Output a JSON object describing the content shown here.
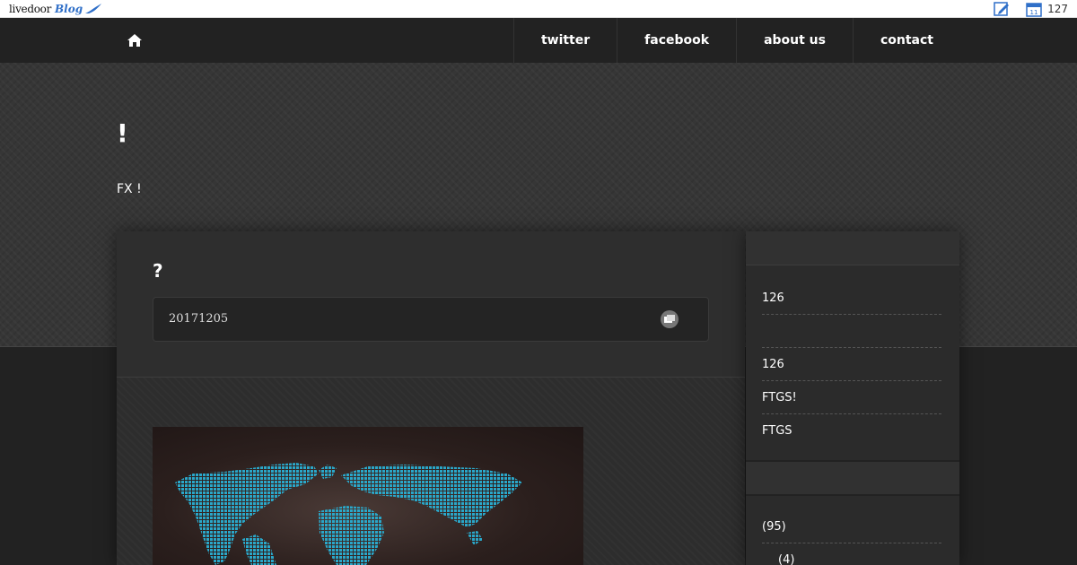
{
  "topbar": {
    "logo_text": "livedoor",
    "logo_blog": "Blog",
    "count": "127",
    "icons": [
      "edit-icon",
      "calendar-icon"
    ]
  },
  "nav": {
    "home_icon": "home-icon",
    "items": [
      {
        "label": "twitter"
      },
      {
        "label": "facebook"
      },
      {
        "label": "about us"
      },
      {
        "label": "contact"
      }
    ]
  },
  "header": {
    "title": "!",
    "description": "FX !"
  },
  "article": {
    "title": "?",
    "date": "20171205",
    "comment_icon": "comment-icon",
    "image": "world-map-image"
  },
  "sidebar": {
    "items1": [
      "126",
      "",
      "126",
      "FTGS!",
      "FTGS"
    ],
    "items2": [
      " (95)",
      "(4)"
    ]
  },
  "colors": {
    "nav_bg": "#222222",
    "header_bg": "#363636",
    "panel_bg": "#2c2c2c",
    "map_dots": "#2aa7c9"
  }
}
